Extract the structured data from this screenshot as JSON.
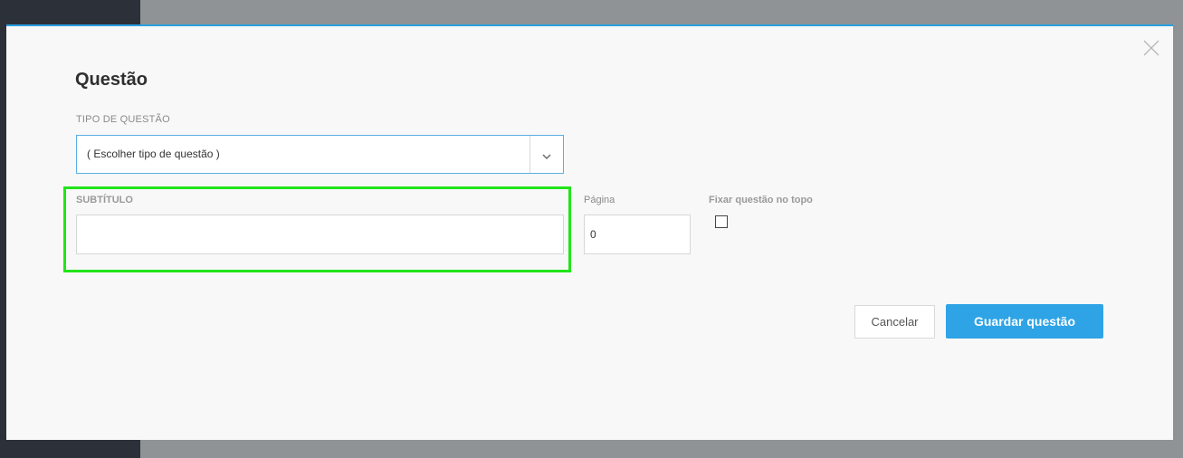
{
  "modal": {
    "title": "Questão",
    "tipo_label": "TIPO DE QUESTÃO",
    "tipo_value": "( Escolher tipo de questão )",
    "subtitulo_label": "SUBTÍTULO",
    "subtitulo_value": "",
    "pagina_label": "Página",
    "pagina_value": "0",
    "fixar_label": "Fixar questão no topo",
    "fixar_checked": false,
    "cancel_label": "Cancelar",
    "save_label": "Guardar questão"
  },
  "icons": {
    "close": "close-icon",
    "chevron": "chevron-down-icon"
  },
  "colors": {
    "accent": "#2ea4e6",
    "highlight": "#22e41a",
    "sidebar": "#2c3038"
  }
}
